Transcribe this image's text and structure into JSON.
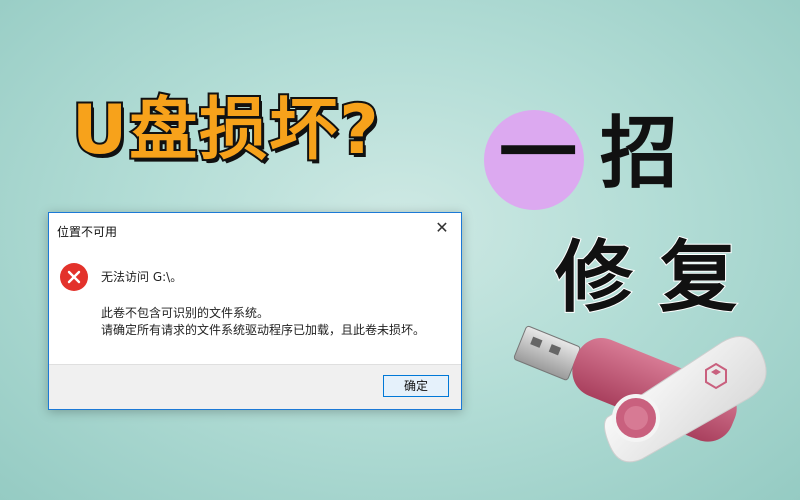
{
  "headline": {
    "text": "U盘损坏?",
    "color": "#f7a21b"
  },
  "tagline": {
    "one": "一",
    "zhao": "招",
    "repair": "修复",
    "circle_color": "#dca9f0"
  },
  "dialog": {
    "title": "位置不可用",
    "close_glyph": "✕",
    "icon": "error-x-icon",
    "message_main": "无法访问 G:\\。",
    "message_line1": "此卷不包含可识别的文件系统。",
    "message_line2": "请确定所有请求的文件系统驱动程序已加载，且此卷未损坏。",
    "ok_label": "确定",
    "error_color": "#e3322b",
    "accent_color": "#0078d7"
  },
  "illustration": {
    "icon": "usb-drive-icon",
    "body_color": "#c9607e",
    "cap_color": "#f4f4f4"
  }
}
